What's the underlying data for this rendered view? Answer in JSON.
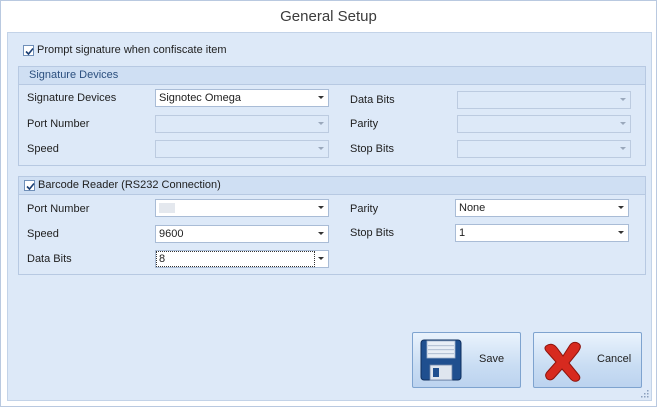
{
  "window": {
    "title": "General Setup"
  },
  "prompt_signature": {
    "label": "Prompt signature when confiscate item",
    "checked": true
  },
  "signature_devices": {
    "group_title": "Signature Devices",
    "devices_label": "Signature Devices",
    "devices_value": "Signotec Omega",
    "port_label": "Port Number",
    "speed_label": "Speed",
    "data_bits_label": "Data Bits",
    "parity_label": "Parity",
    "stop_bits_label": "Stop Bits"
  },
  "barcode_reader": {
    "group_title": "Barcode Reader (RS232 Connection)",
    "checked": true,
    "port_label": "Port Number",
    "port_value": "",
    "speed_label": "Speed",
    "speed_value": "9600",
    "data_bits_label": "Data Bits",
    "data_bits_value": "8",
    "parity_label": "Parity",
    "parity_value": "None",
    "stop_bits_label": "Stop Bits",
    "stop_bits_value": "1"
  },
  "buttons": {
    "save_label": "Save",
    "cancel_label": "Cancel"
  },
  "icons": {
    "save": "floppy-disk-icon",
    "cancel": "red-x-icon"
  },
  "colors": {
    "background": "#dde9f8",
    "group_header": "#cfdff3",
    "group_title_text": "#2b4f7e",
    "checkmark": "#1b3f73"
  }
}
